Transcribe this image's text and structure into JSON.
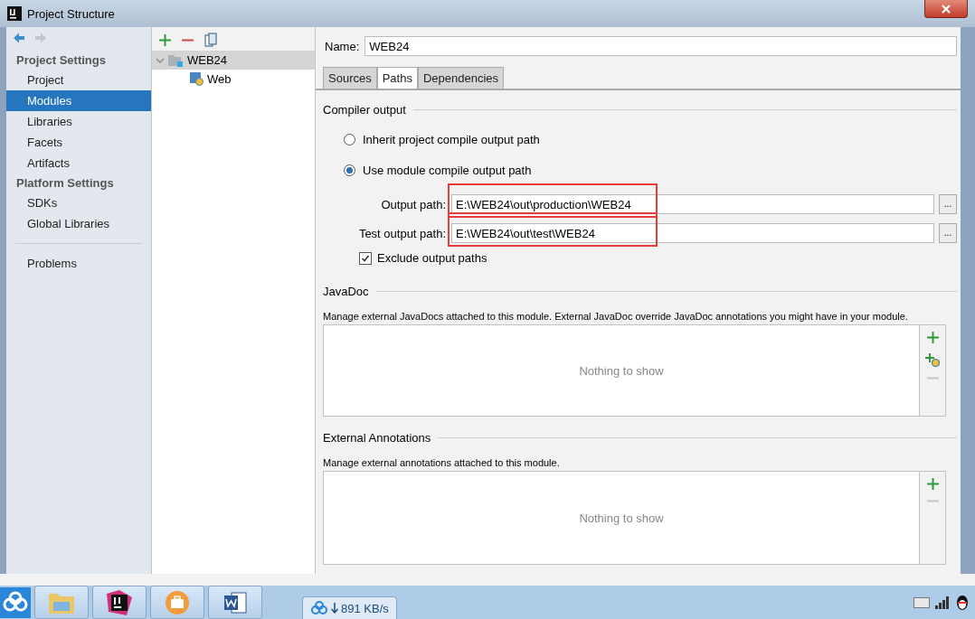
{
  "window": {
    "title": "Project Structure"
  },
  "sidebar": {
    "sections": [
      {
        "heading": "Project Settings",
        "items": [
          {
            "label": "Project",
            "selected": false
          },
          {
            "label": "Modules",
            "selected": true
          },
          {
            "label": "Libraries",
            "selected": false
          },
          {
            "label": "Facets",
            "selected": false
          },
          {
            "label": "Artifacts",
            "selected": false
          }
        ]
      },
      {
        "heading": "Platform Settings",
        "items": [
          {
            "label": "SDKs",
            "selected": false
          },
          {
            "label": "Global Libraries",
            "selected": false
          }
        ]
      }
    ],
    "extra_items": [
      {
        "label": "Problems",
        "selected": false
      }
    ]
  },
  "tree": {
    "items": [
      {
        "label": "WEB24",
        "selected": true,
        "expanded": true,
        "children": [
          {
            "label": "Web",
            "selected": false
          }
        ]
      }
    ]
  },
  "module": {
    "name_label": "Name:",
    "name": "WEB24",
    "tabs": [
      {
        "label": "Sources",
        "selected": false
      },
      {
        "label": "Paths",
        "selected": true
      },
      {
        "label": "Dependencies",
        "selected": false
      }
    ],
    "compiler_output": {
      "title": "Compiler output",
      "options": [
        {
          "label": "Inherit project compile output path",
          "selected": false
        },
        {
          "label": "Use module compile output path",
          "selected": true
        }
      ],
      "fields": [
        {
          "label": "Output path:",
          "value": "E:\\WEB24\\out\\production\\WEB24",
          "button": "...",
          "highlighted": true
        },
        {
          "label": "Test output path:",
          "value": "E:\\WEB24\\out\\test\\WEB24",
          "button": "...",
          "highlighted": true
        }
      ],
      "exclude": {
        "label": "Exclude output paths",
        "checked": true
      }
    },
    "javadoc": {
      "title": "JavaDoc",
      "description": "Manage external JavaDocs attached to this module. External JavaDoc override JavaDoc annotations you might have in your module.",
      "empty_text": "Nothing to show"
    },
    "annotations": {
      "title": "External Annotations",
      "description": "Manage external annotations attached to this module.",
      "empty_text": "Nothing to show"
    }
  },
  "taskbar": {
    "speed": "891 KB/s"
  }
}
